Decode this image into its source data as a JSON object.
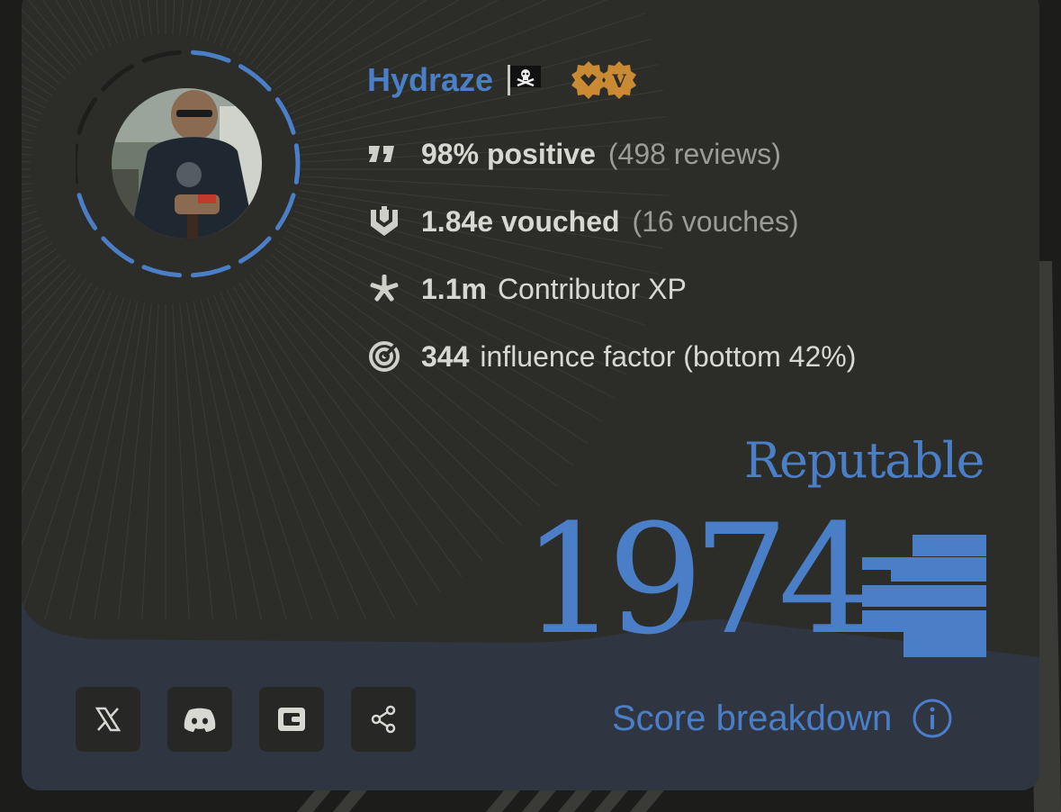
{
  "profile": {
    "name": "Hydraze",
    "flag_icon": "pirate-flag-icon",
    "badges_icon": "verified-badges-icon",
    "avatar_icon": "user-photo-avatar"
  },
  "stats": {
    "reviews": {
      "icon": "quote-icon",
      "value": "98% positive",
      "detail": "(498 reviews)"
    },
    "vouches": {
      "icon": "shield-vouch-icon",
      "value": "1.84e vouched",
      "detail": "(16 vouches)"
    },
    "xp": {
      "icon": "sparkle-star-icon",
      "value": "1.1m",
      "label": "Contributor XP"
    },
    "influence": {
      "icon": "radar-target-icon",
      "value": "344",
      "label": "influence factor (bottom 42%)"
    }
  },
  "score": {
    "level": "Reputable",
    "value": "1974",
    "ring_progress": 0.7,
    "mark_icon": "score-level-mark-icon"
  },
  "footer": {
    "social": [
      "x-icon",
      "discord-icon",
      "wallet-icon",
      "share-icon"
    ],
    "breakdown_label": "Score breakdown",
    "breakdown_icon": "info-icon"
  },
  "colors": {
    "accent": "#4a7fc8",
    "card": "#2c2c29",
    "footer": "#2f3642",
    "text_strong": "#d8d8d3",
    "text_muted": "#9c9c97",
    "badge_gold": "#c98a33"
  }
}
